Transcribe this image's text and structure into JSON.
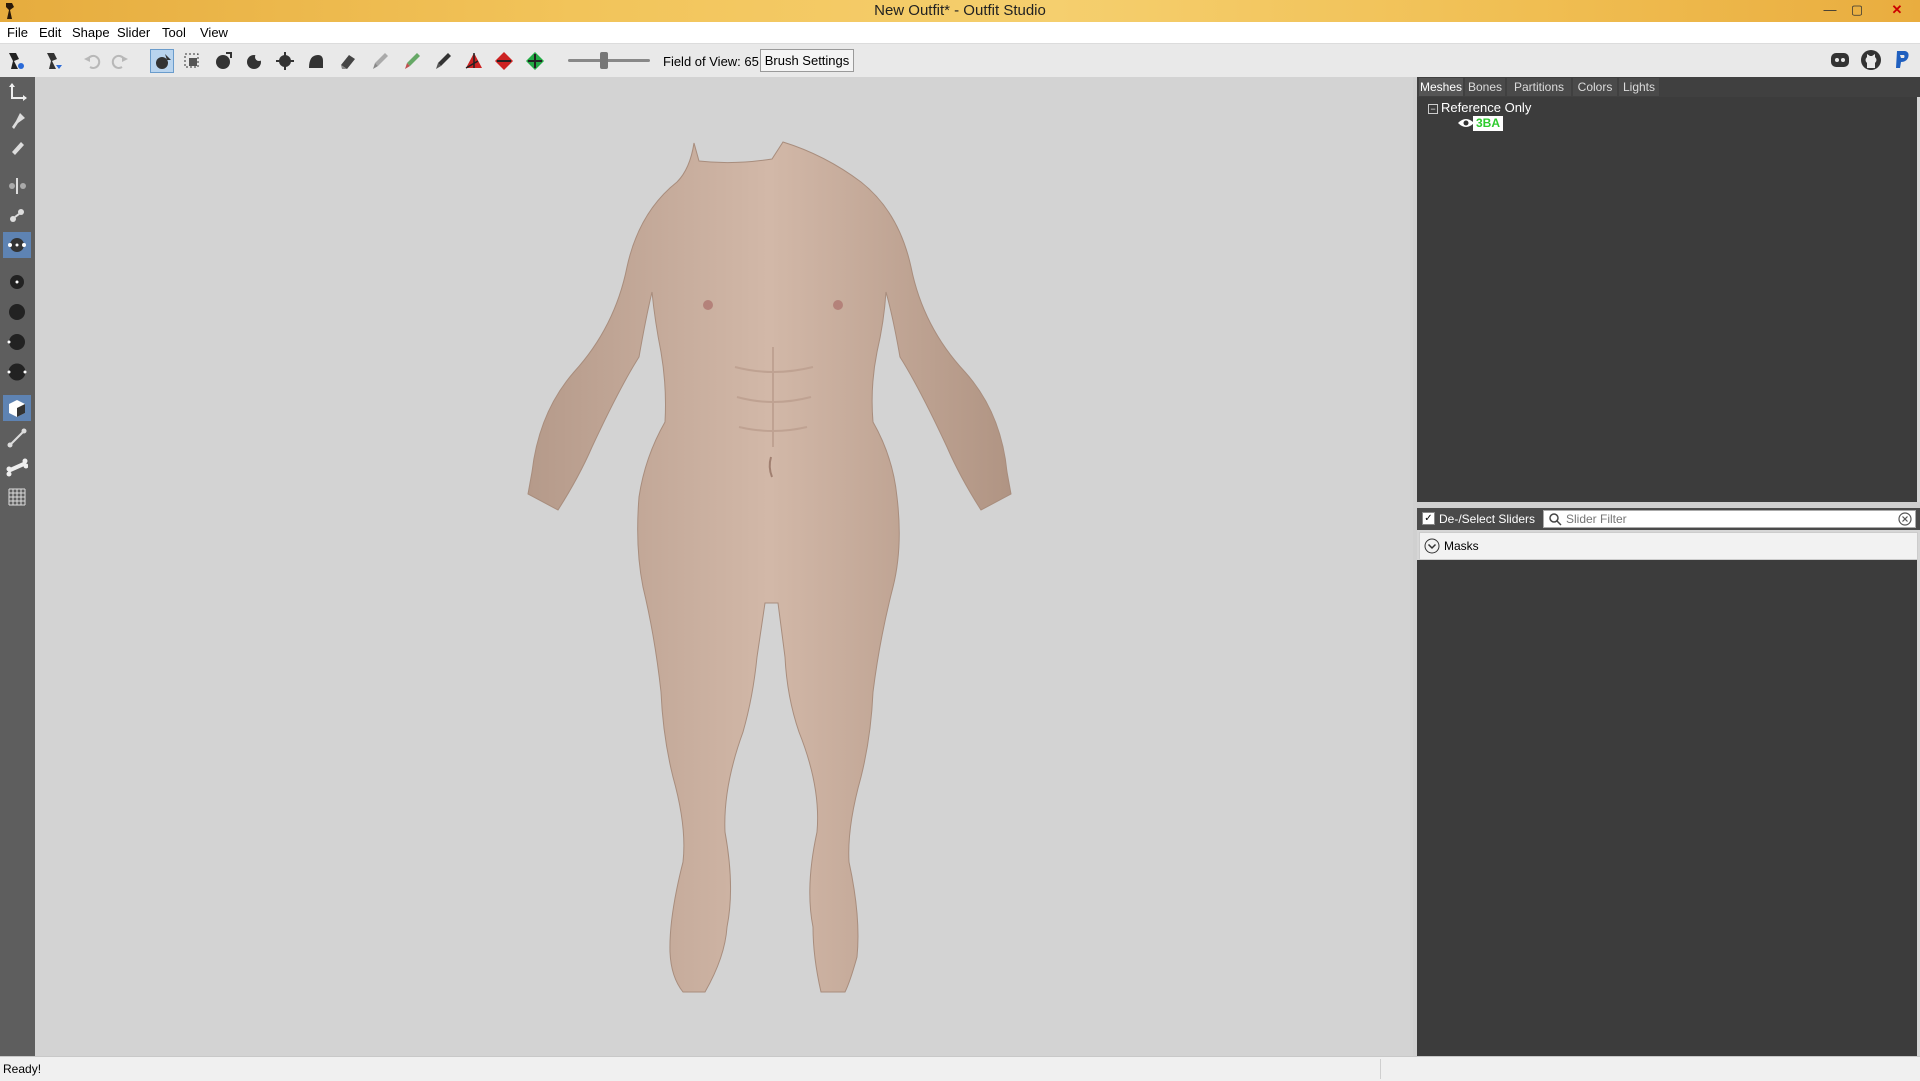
{
  "window": {
    "title": "New Outfit* - Outfit Studio",
    "controls": {
      "minimize": "—",
      "maximize": "▢",
      "close": "✕"
    }
  },
  "menu": [
    "File",
    "Edit",
    "Shape",
    "Slider",
    "Tool",
    "View"
  ],
  "toolbar": {
    "fov_label": "Field of View: 65",
    "fov_value": 65,
    "brush_settings_label": "Brush Settings",
    "icons": [
      "load-project-icon",
      "save-project-icon",
      "undo-icon",
      "redo-icon",
      "select-brush-icon",
      "mask-select-icon",
      "inflate-brush-icon",
      "deflate-brush-icon",
      "move-brush-icon",
      "smooth-brush-icon",
      "mask-brush-icon",
      "weight-brush-icon",
      "color-brush-icon",
      "alpha-brush-icon",
      "collapse-vertex-icon",
      "flip-edge-icon",
      "split-edge-icon"
    ],
    "right_icons": [
      "discord-icon",
      "github-icon",
      "paypal-icon"
    ]
  },
  "left_tools": [
    "transform-icon",
    "pivot-icon",
    "vertex-select-icon",
    "mirror-x-icon",
    "mirror-y-icon",
    "mirror-z-icon",
    "brush-size-small-icon",
    "brush-size-medium-icon",
    "brush-size-large-icon",
    "brush-size-xlarge-icon",
    "xray-cube-icon",
    "bone-icon",
    "bone-flip-icon",
    "wireframe-grid-icon"
  ],
  "right_panel": {
    "tabs": [
      "Meshes",
      "Bones",
      "Partitions",
      "Colors",
      "Lights"
    ],
    "active_tab": "Meshes",
    "tree_root": "Reference Only",
    "tree_toggle": "−",
    "mesh": "3BA",
    "deselect_sliders_label": "De-/Select Sliders",
    "check_mark": "✓",
    "slider_filter_placeholder": "Slider Filter",
    "slider_filter_value": "",
    "masks_label": "Masks"
  },
  "status": {
    "text": "Ready!"
  },
  "colors": {
    "accent_active": "#5e83b3",
    "mesh_label": "#2ecb2e",
    "viewport_bg": "#d3d3d3",
    "panel_bg": "#3c3c3c"
  }
}
